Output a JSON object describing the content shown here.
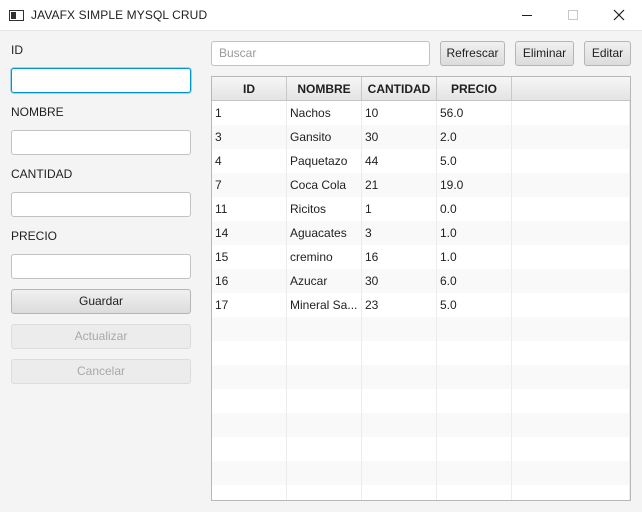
{
  "window": {
    "title": "JAVAFX SIMPLE MYSQL CRUD",
    "icons": {
      "app": "app-window-icon",
      "minimize": "minimize-icon",
      "maximize": "maximize-icon",
      "close": "close-icon"
    }
  },
  "form": {
    "id_label": "ID",
    "id_value": "",
    "nombre_label": "NOMBRE",
    "nombre_value": "",
    "cantidad_label": "CANTIDAD",
    "cantidad_value": "",
    "precio_label": "PRECIO",
    "precio_value": "",
    "guardar_label": "Guardar",
    "actualizar_label": "Actualizar",
    "cancelar_label": "Cancelar"
  },
  "toolbar": {
    "search_placeholder": "Buscar",
    "search_value": "",
    "refrescar_label": "Refrescar",
    "eliminar_label": "Eliminar",
    "editar_label": "Editar"
  },
  "table": {
    "columns": [
      "ID",
      "NOMBRE",
      "CANTIDAD",
      "PRECIO"
    ],
    "rows": [
      [
        "1",
        "Nachos",
        "10",
        "56.0"
      ],
      [
        "3",
        "Gansito",
        "30",
        "2.0"
      ],
      [
        "4",
        "Paquetazo",
        "44",
        "5.0"
      ],
      [
        "7",
        "Coca Cola",
        "21",
        "19.0"
      ],
      [
        "11",
        "Ricitos",
        "1",
        "0.0"
      ],
      [
        "14",
        "Aguacates",
        "3",
        "1.0"
      ],
      [
        "15",
        "cremino",
        "16",
        "1.0"
      ],
      [
        "16",
        "Azucar",
        "30",
        "6.0"
      ],
      [
        "17",
        "Mineral Sa...",
        "23",
        "5.0"
      ]
    ]
  },
  "colors": {
    "focus": "#0096c9",
    "close_icon": "#1f1f1f"
  }
}
